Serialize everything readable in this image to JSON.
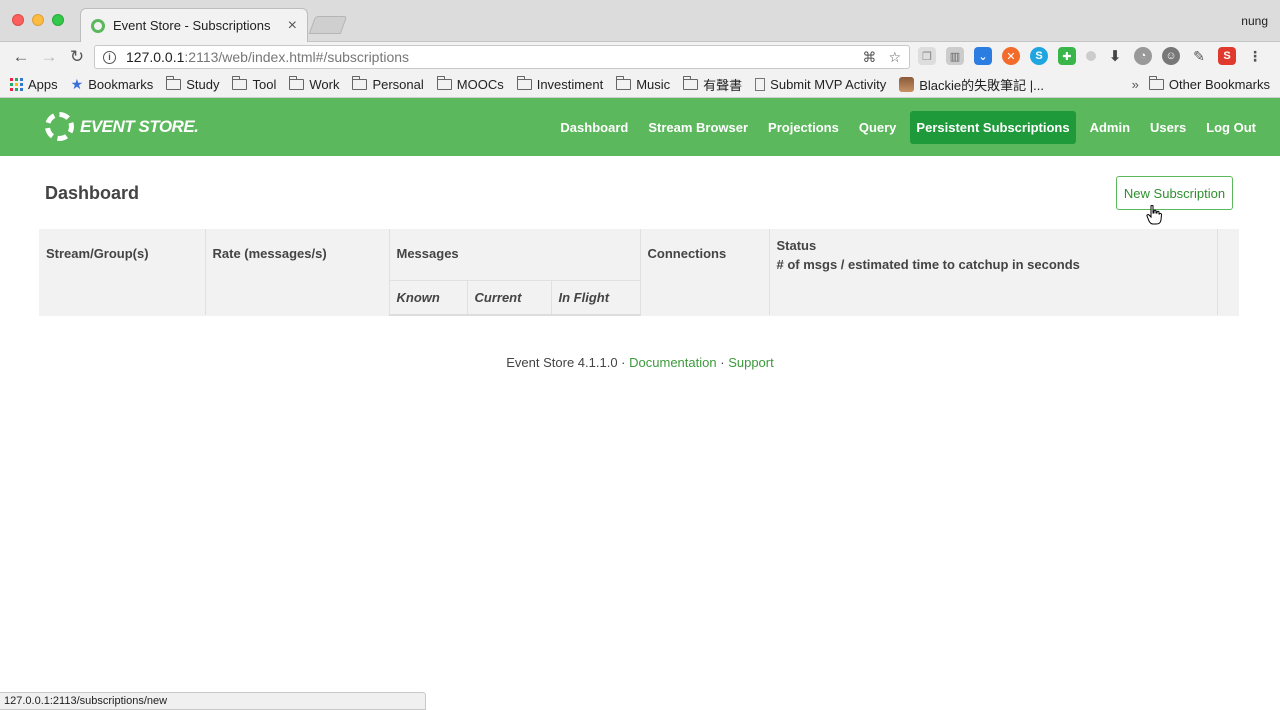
{
  "browser": {
    "tab_title": "Event Store - Subscriptions",
    "tab_close": "×",
    "profile_name": "nung",
    "url_host": "127.0.0.1",
    "url_rest": ":2113/web/index.html#/subscriptions",
    "status_url": "127.0.0.1:2113/subscriptions/new"
  },
  "bookmarks": [
    {
      "label": "Apps",
      "icon": "apps-icon"
    },
    {
      "label": "Bookmarks",
      "icon": "star-icon"
    },
    {
      "label": "Study",
      "icon": "folder-icon"
    },
    {
      "label": "Tool",
      "icon": "folder-icon"
    },
    {
      "label": "Work",
      "icon": "folder-icon"
    },
    {
      "label": "Personal",
      "icon": "folder-icon"
    },
    {
      "label": "MOOCs",
      "icon": "folder-icon"
    },
    {
      "label": "Investiment",
      "icon": "folder-icon"
    },
    {
      "label": "Music",
      "icon": "folder-icon"
    },
    {
      "label": "有聲書",
      "icon": "folder-icon"
    },
    {
      "label": "Submit MVP Activity",
      "icon": "page-icon"
    },
    {
      "label": "Blackie的失敗筆記 |...",
      "icon": "avatar-icon"
    }
  ],
  "bookmarks_more": "»",
  "other_bookmarks": "Other Bookmarks",
  "app": {
    "logo_text": "EVENT STORE.",
    "nav": [
      {
        "label": "Dashboard",
        "active": false
      },
      {
        "label": "Stream Browser",
        "active": false
      },
      {
        "label": "Projections",
        "active": false
      },
      {
        "label": "Query",
        "active": false
      },
      {
        "label": "Persistent Subscriptions",
        "active": true
      },
      {
        "label": "Admin",
        "active": false
      },
      {
        "label": "Users",
        "active": false
      },
      {
        "label": "Log Out",
        "active": false
      }
    ],
    "page_title": "Dashboard",
    "new_subscription_label": "New Subscription",
    "brand_color": "#5cb85c",
    "active_nav_color": "#1e9a3b"
  },
  "table": {
    "col_stream": "Stream/Group(s)",
    "col_rate": "Rate (messages/s)",
    "col_messages": "Messages",
    "col_known": "Known",
    "col_current": "Current",
    "col_inflight": "In Flight",
    "col_connections": "Connections",
    "col_status": "Status",
    "col_status_sub": "# of msgs / estimated time to catchup in seconds"
  },
  "footer": {
    "version": "Event Store 4.1.1.0",
    "sep": "·",
    "documentation": "Documentation",
    "support": "Support"
  }
}
